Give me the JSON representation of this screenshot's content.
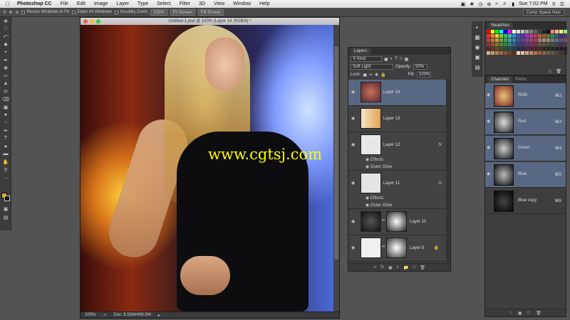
{
  "menubar": {
    "app_name": "Photoshop CC",
    "menus": [
      "File",
      "Edit",
      "Image",
      "Layer",
      "Type",
      "Select",
      "Filter",
      "3D",
      "View",
      "Window",
      "Help"
    ],
    "clock": "Sun 7:02 PM"
  },
  "options_bar": {
    "resize_windows": "Resize Windows to Fit",
    "zoom_all": "Zoom All Windows",
    "scrubby_zoom": "Scrubby Zoom",
    "btn_100": "100%",
    "btn_fit": "Fit Screen",
    "btn_fill": "Fill Screen",
    "workspace": "Comp Space New"
  },
  "document": {
    "title": "Untitled-1.psd @ 100% (Layer 14, RGB/8) *",
    "zoom": "100%",
    "doc_size": "Doc: 8.58M/499.5M"
  },
  "watermark": "www.cgtsj.com",
  "layers_panel": {
    "tab": "Layers",
    "filter": "Kind",
    "blend_mode": "Soft Light",
    "opacity_label": "Opacity:",
    "opacity": "50%",
    "lock_label": "Lock:",
    "fill_label": "Fill:",
    "fill": "100%",
    "layers": [
      {
        "name": "Layer 14"
      },
      {
        "name": "Layer 13"
      },
      {
        "name": "Layer 12",
        "effects": "Effects",
        "effect": "Outer Glow"
      },
      {
        "name": "Layer 11",
        "effects": "Effects",
        "effect": "Outer Glow"
      },
      {
        "name": "Layer 10"
      },
      {
        "name": "Layer 8"
      }
    ],
    "fx": "fx"
  },
  "swatches_panel": {
    "tab": "Swatches"
  },
  "channels_panel": {
    "tabs": [
      "Channels",
      "Paths"
    ],
    "channels": [
      {
        "name": "RGB",
        "key": "⌘2"
      },
      {
        "name": "Red",
        "key": "⌘3"
      },
      {
        "name": "Green",
        "key": "⌘4"
      },
      {
        "name": "Blue",
        "key": "⌘5"
      },
      {
        "name": "Blue copy",
        "key": "⌘6"
      }
    ]
  },
  "colors": {
    "foreground": "#e6a51f",
    "background": "#111111",
    "selection": "#596882"
  },
  "swatch_colors": [
    "#ff0000",
    "#ffff00",
    "#00ff00",
    "#00ffff",
    "#0000ff",
    "#ff00ff",
    "#ffffff",
    "#e0e0e0",
    "#c0c0c0",
    "#a0a0a0",
    "#808080",
    "#606060",
    "#404040",
    "#202020",
    "#000000",
    "#ff8080",
    "#ffc080",
    "#ffff80",
    "#80ff80",
    "#f03030",
    "#f08030",
    "#f0d030",
    "#80d030",
    "#30c060",
    "#30c0b0",
    "#3090d0",
    "#3050c0",
    "#6030c0",
    "#a030c0",
    "#d030a0",
    "#d03060",
    "#b06040",
    "#906030",
    "#707030",
    "#408050",
    "#306080",
    "#403080",
    "#603060",
    "#c04040",
    "#c07040",
    "#c0a040",
    "#70a040",
    "#40a060",
    "#40a0a0",
    "#4080b0",
    "#4050a0",
    "#6040a0",
    "#8040a0",
    "#a04080",
    "#a04060",
    "#a08060",
    "#a09070",
    "#909080",
    "#708070",
    "#607080",
    "#605080",
    "#705070",
    "#903030",
    "#905030",
    "#907030",
    "#608030",
    "#308050",
    "#308080",
    "#306090",
    "#304080",
    "#503080",
    "#703080",
    "#803060",
    "#803040",
    "#705040",
    "#605040",
    "#505040",
    "#405040",
    "#404050",
    "#403050",
    "#503040",
    "#602020",
    "#603820",
    "#605020",
    "#405020",
    "#205030",
    "#205050",
    "#204060",
    "#203050",
    "#302050",
    "#502050",
    "#502040",
    "#502030",
    "#403020",
    "#302818",
    "#282818",
    "#203018",
    "#182030",
    "#201830",
    "#281820",
    "#d8b090",
    "#c89878",
    "#b88060",
    "#a86848",
    "#905030",
    "#784020",
    "#603010",
    "#f0d8c0",
    "#e0c0a0",
    "#d0a880",
    "#c09060",
    "#b07850",
    "#a06040",
    "#886050",
    "#706050",
    "#605850",
    "#504840",
    "#403830",
    "#302820"
  ]
}
